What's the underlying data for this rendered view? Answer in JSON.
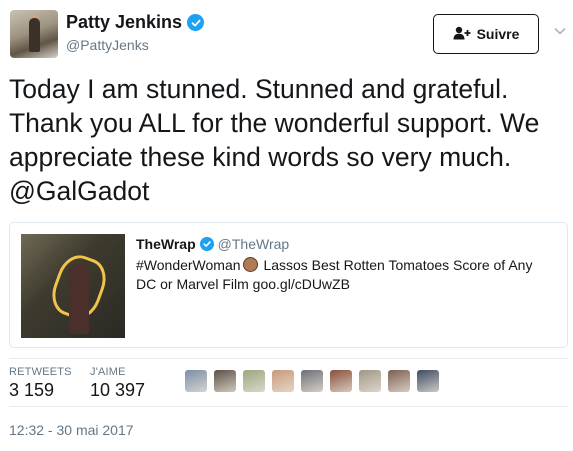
{
  "author": {
    "name": "Patty Jenkins",
    "handle": "@PattyJenks"
  },
  "follow_button": {
    "label": "Suivre"
  },
  "tweet": {
    "text": "Today I am stunned. Stunned and grateful. Thank you ALL for the wonderful support. We appreciate these kind words so very much. @GalGadot"
  },
  "quoted_card": {
    "name": "TheWrap",
    "handle": "@TheWrap",
    "text_before_emoji": "#WonderWoman",
    "text_after_emoji": "Lassos Best Rotten Tomatoes Score of Any DC or Marvel Film goo.gl/cDUwZB"
  },
  "stats": {
    "retweets_label": "RETWEETS",
    "retweets_value": "3 159",
    "likes_label": "J'AIME",
    "likes_value": "10 397"
  },
  "likers": [
    {
      "icon": "user-avatar",
      "color": "#7a8fa8"
    },
    {
      "icon": "user-avatar",
      "color": "#5b5046"
    },
    {
      "icon": "user-avatar",
      "color": "#9aa77f"
    },
    {
      "icon": "user-avatar",
      "color": "#c89a7a"
    },
    {
      "icon": "user-avatar",
      "color": "#6d6f78"
    },
    {
      "icon": "user-avatar",
      "color": "#8a4e3c"
    },
    {
      "icon": "user-avatar",
      "color": "#a09886"
    },
    {
      "icon": "user-avatar",
      "color": "#7d5e52"
    },
    {
      "icon": "user-avatar",
      "color": "#3d4c63"
    }
  ],
  "timestamp": "12:32 - 30 mai 2017",
  "colors": {
    "verified": "#1da1f2",
    "secondary_text": "#657786",
    "primary_text": "#14171a"
  }
}
